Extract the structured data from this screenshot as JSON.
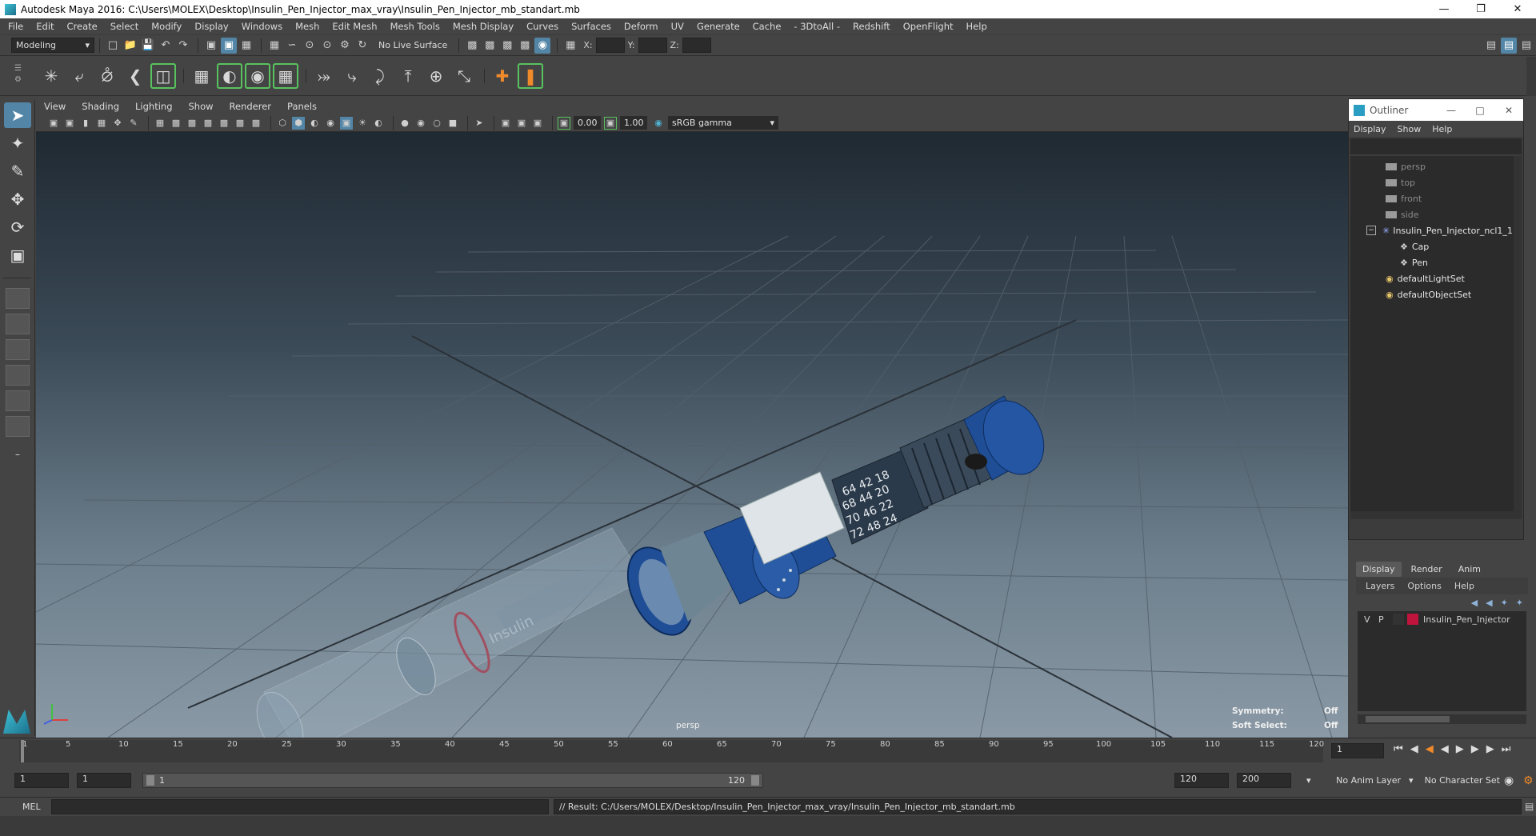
{
  "window": {
    "title": "Autodesk Maya 2016: C:\\Users\\MOLEX\\Desktop\\Insulin_Pen_Injector_max_vray\\Insulin_Pen_Injector_mb_standart.mb"
  },
  "menubar": [
    "File",
    "Edit",
    "Create",
    "Select",
    "Modify",
    "Display",
    "Windows",
    "Mesh",
    "Edit Mesh",
    "Mesh Tools",
    "Mesh Display",
    "Curves",
    "Surfaces",
    "Deform",
    "UV",
    "Generate",
    "Cache",
    "- 3DtoAll -",
    "Redshift",
    "OpenFlight",
    "Help"
  ],
  "statusline": {
    "mode": "Modeling",
    "live_surface": "No Live Surface",
    "x_label": "X:",
    "y_label": "Y:",
    "z_label": "Z:"
  },
  "panel_menu": [
    "View",
    "Shading",
    "Lighting",
    "Show",
    "Renderer",
    "Panels"
  ],
  "panel_bar": {
    "exposure": "0.00",
    "gamma": "1.00",
    "color_space": "sRGB gamma"
  },
  "viewport": {
    "camera_label": "persp",
    "symmetry_label": "Symmetry:",
    "symmetry_value": "Off",
    "soft_select_label": "Soft Select:",
    "soft_select_value": "Off"
  },
  "model_text": {
    "brand": "Insulin",
    "dial_numbers": [
      "64 42 18",
      "68 44 20",
      "70 46 22",
      "72 48 24"
    ]
  },
  "outliner": {
    "title": "Outliner",
    "menu": [
      "Display",
      "Show",
      "Help"
    ],
    "items": [
      {
        "label": "persp",
        "dim": true
      },
      {
        "label": "top",
        "dim": true
      },
      {
        "label": "front",
        "dim": true
      },
      {
        "label": "side",
        "dim": true
      },
      {
        "label": "Insulin_Pen_Injector_ncl1_1",
        "dim": false
      },
      {
        "label": "Cap",
        "dim": false
      },
      {
        "label": "Pen",
        "dim": false
      },
      {
        "label": "defaultLightSet",
        "dim": false
      },
      {
        "label": "defaultObjectSet",
        "dim": false
      }
    ]
  },
  "layer_panel": {
    "tabs": [
      "Display",
      "Render",
      "Anim"
    ],
    "menu": [
      "Layers",
      "Options",
      "Help"
    ],
    "layer": {
      "v": "V",
      "p": "P",
      "name": "Insulin_Pen_Injector",
      "color": "#c0143c"
    }
  },
  "timeslider": {
    "ticks": [
      "1",
      "5",
      "10",
      "15",
      "20",
      "25",
      "30",
      "35",
      "40",
      "45",
      "50",
      "55",
      "60",
      "65",
      "70",
      "75",
      "80",
      "85",
      "90",
      "95",
      "100",
      "105",
      "110",
      "115",
      "120"
    ],
    "current_frame": "1"
  },
  "range": {
    "start": "1",
    "start_inner": "1",
    "slider_start": "1",
    "slider_end": "120",
    "end_inner": "120",
    "end": "200",
    "anim_layer": "No Anim Layer",
    "char_set": "No Character Set"
  },
  "cmdline": {
    "lang": "MEL",
    "result": "// Result: C:/Users/MOLEX/Desktop/Insulin_Pen_Injector_max_vray/Insulin_Pen_Injector_mb_standart.mb"
  }
}
